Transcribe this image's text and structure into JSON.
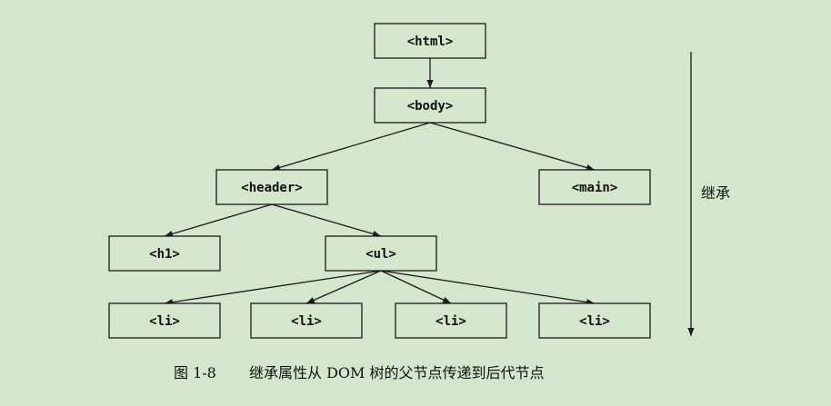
{
  "diagram": {
    "nodes": {
      "html": "<html>",
      "body": "<body>",
      "header": "<header>",
      "main": "<main>",
      "h1": "<h1>",
      "ul": "<ul>",
      "li1": "<li>",
      "li2": "<li>",
      "li3": "<li>",
      "li4": "<li>"
    },
    "edges": [
      [
        "html",
        "body"
      ],
      [
        "body",
        "header"
      ],
      [
        "body",
        "main"
      ],
      [
        "header",
        "h1"
      ],
      [
        "header",
        "ul"
      ],
      [
        "ul",
        "li1"
      ],
      [
        "ul",
        "li2"
      ],
      [
        "ul",
        "li3"
      ],
      [
        "ul",
        "li4"
      ]
    ],
    "side_label": "继承",
    "caption_number": "图 1-8",
    "caption_text": "继承属性从 DOM 树的父节点传递到后代节点"
  }
}
